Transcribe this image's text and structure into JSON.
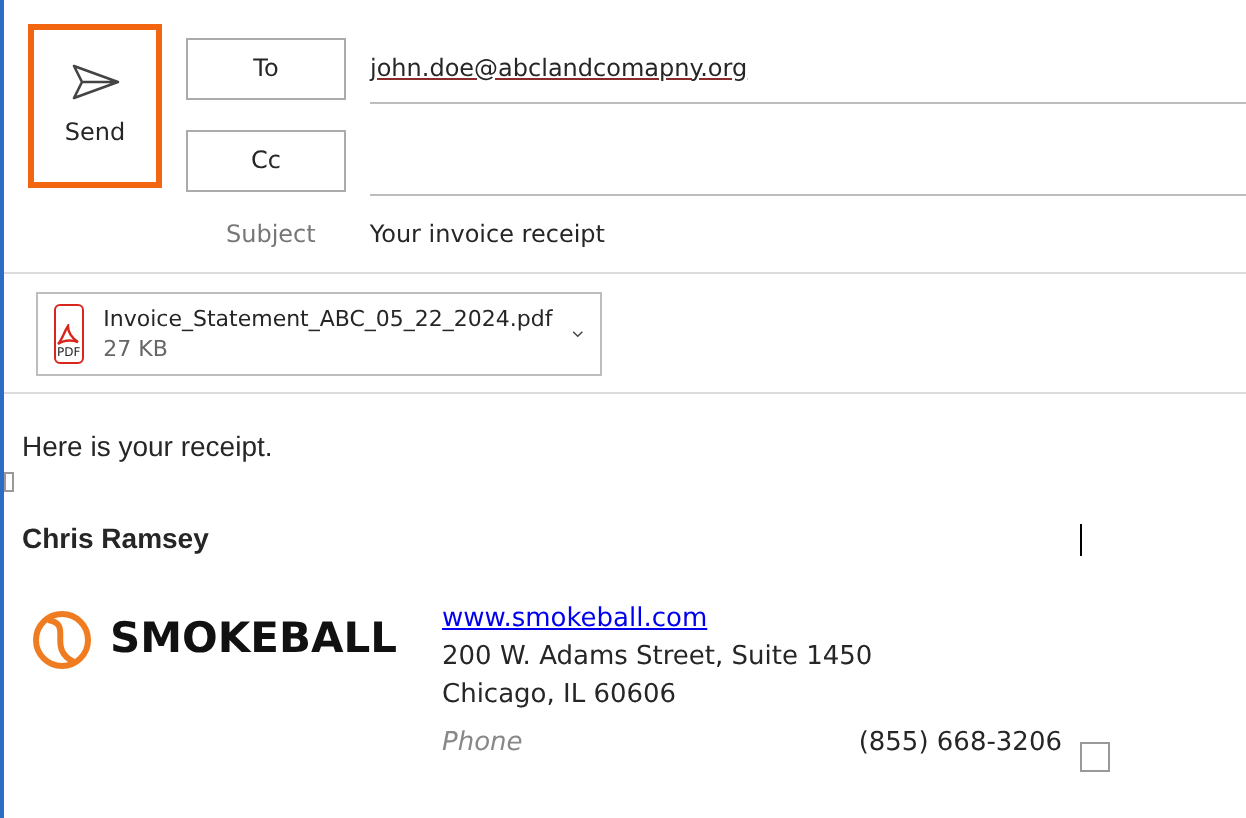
{
  "send_button": {
    "label": "Send"
  },
  "recipients": [
    {
      "label": "To",
      "value": "john.doe@abclandcomapny.org"
    },
    {
      "label": "Cc"
    }
  ],
  "subject": {
    "label": "Subject",
    "value": "Your invoice receipt"
  },
  "attachment": {
    "name": "Invoice_Statement_ABC_05_22_2024.pdf",
    "size": "27 KB",
    "badge": "PDF"
  },
  "body": {
    "greeting": "Here is your receipt.",
    "signature": {
      "name": "Chris Ramsey",
      "logo_text": "SMOKEBALL",
      "website": "www.smokeball.com",
      "address_line_1": "200 W. Adams Street, Suite 1450",
      "address_line_2": "Chicago, IL 60606",
      "phone_label": "Phone",
      "phone": "(855) 668-3206"
    }
  }
}
